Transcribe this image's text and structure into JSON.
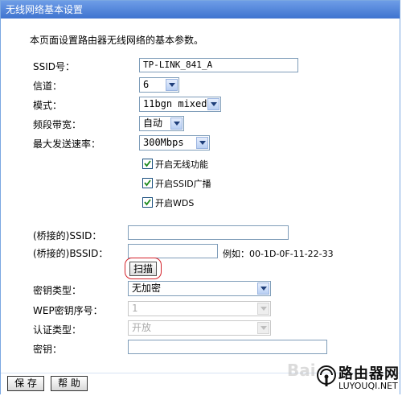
{
  "window": {
    "title": "无线网络基本设置"
  },
  "intro": "本页面设置路由器无线网络的基本参数。",
  "form": {
    "ssid": {
      "label": "SSID号：",
      "value": "TP-LINK_841_A"
    },
    "channel": {
      "label": "信道：",
      "value": "6"
    },
    "mode": {
      "label": "模式：",
      "value": "11bgn mixed"
    },
    "bandwidth": {
      "label": "频段带宽：",
      "value": "自动"
    },
    "max_rate": {
      "label": "最大发送速率：",
      "value": "300Mbps"
    },
    "checkboxes": [
      {
        "label": "开启无线功能",
        "checked": true
      },
      {
        "label": "开启SSID广播",
        "checked": true
      },
      {
        "label": "开启WDS",
        "checked": true
      }
    ],
    "bridge_ssid": {
      "label": "(桥接的)SSID：",
      "value": ""
    },
    "bridge_bssid": {
      "label": "(桥接的)BSSID：",
      "value": "",
      "example": "例如：00-1D-0F-11-22-33"
    },
    "scan_label": "扫描",
    "key_type": {
      "label": "密钥类型：",
      "value": "无加密"
    },
    "wep_index": {
      "label": "WEP密钥序号：",
      "value": "1"
    },
    "auth_type": {
      "label": "认证类型：",
      "value": "开放"
    },
    "key": {
      "label": "密钥：",
      "value": ""
    }
  },
  "buttons": {
    "save": "保 存",
    "help": "帮 助"
  },
  "watermark": {
    "baidu": "Bai",
    "site_name": "路由器网",
    "site_url": "LUYOUQI.NET"
  },
  "colors": {
    "title_bar": "#4a7fd6",
    "highlight_ring": "#d4222a",
    "field_border": "#7f9db9"
  }
}
